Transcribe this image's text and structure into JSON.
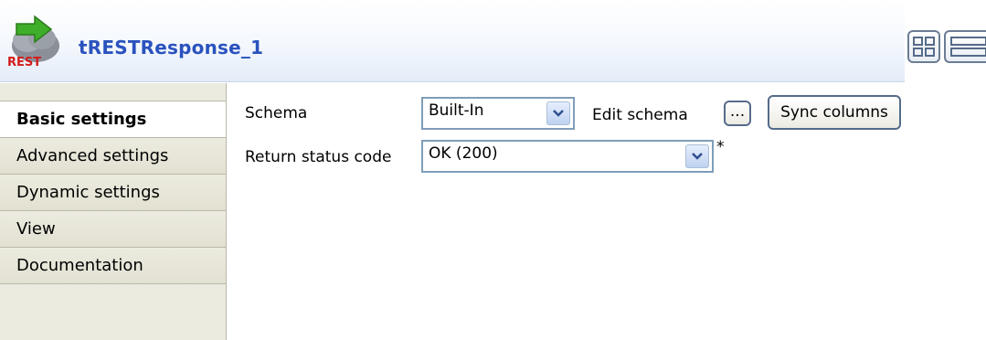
{
  "component": {
    "title": "tRESTResponse_1",
    "icon_badge": "REST"
  },
  "sidebar": {
    "tabs": [
      {
        "label": "Basic settings",
        "active": true
      },
      {
        "label": "Advanced settings",
        "active": false
      },
      {
        "label": "Dynamic settings",
        "active": false
      },
      {
        "label": "View",
        "active": false
      },
      {
        "label": "Documentation",
        "active": false
      }
    ]
  },
  "form": {
    "schema_label": "Schema",
    "schema_value": "Built-In",
    "edit_schema_label": "Edit schema",
    "edit_schema_button": "...",
    "sync_columns_button": "Sync columns",
    "status_code_label": "Return status code",
    "status_code_value": "OK (200)",
    "required_marker": "*"
  },
  "colors": {
    "title": "#2a52be",
    "sidebar_bg": "#ecebdf",
    "field_border": "#7f9db9"
  }
}
